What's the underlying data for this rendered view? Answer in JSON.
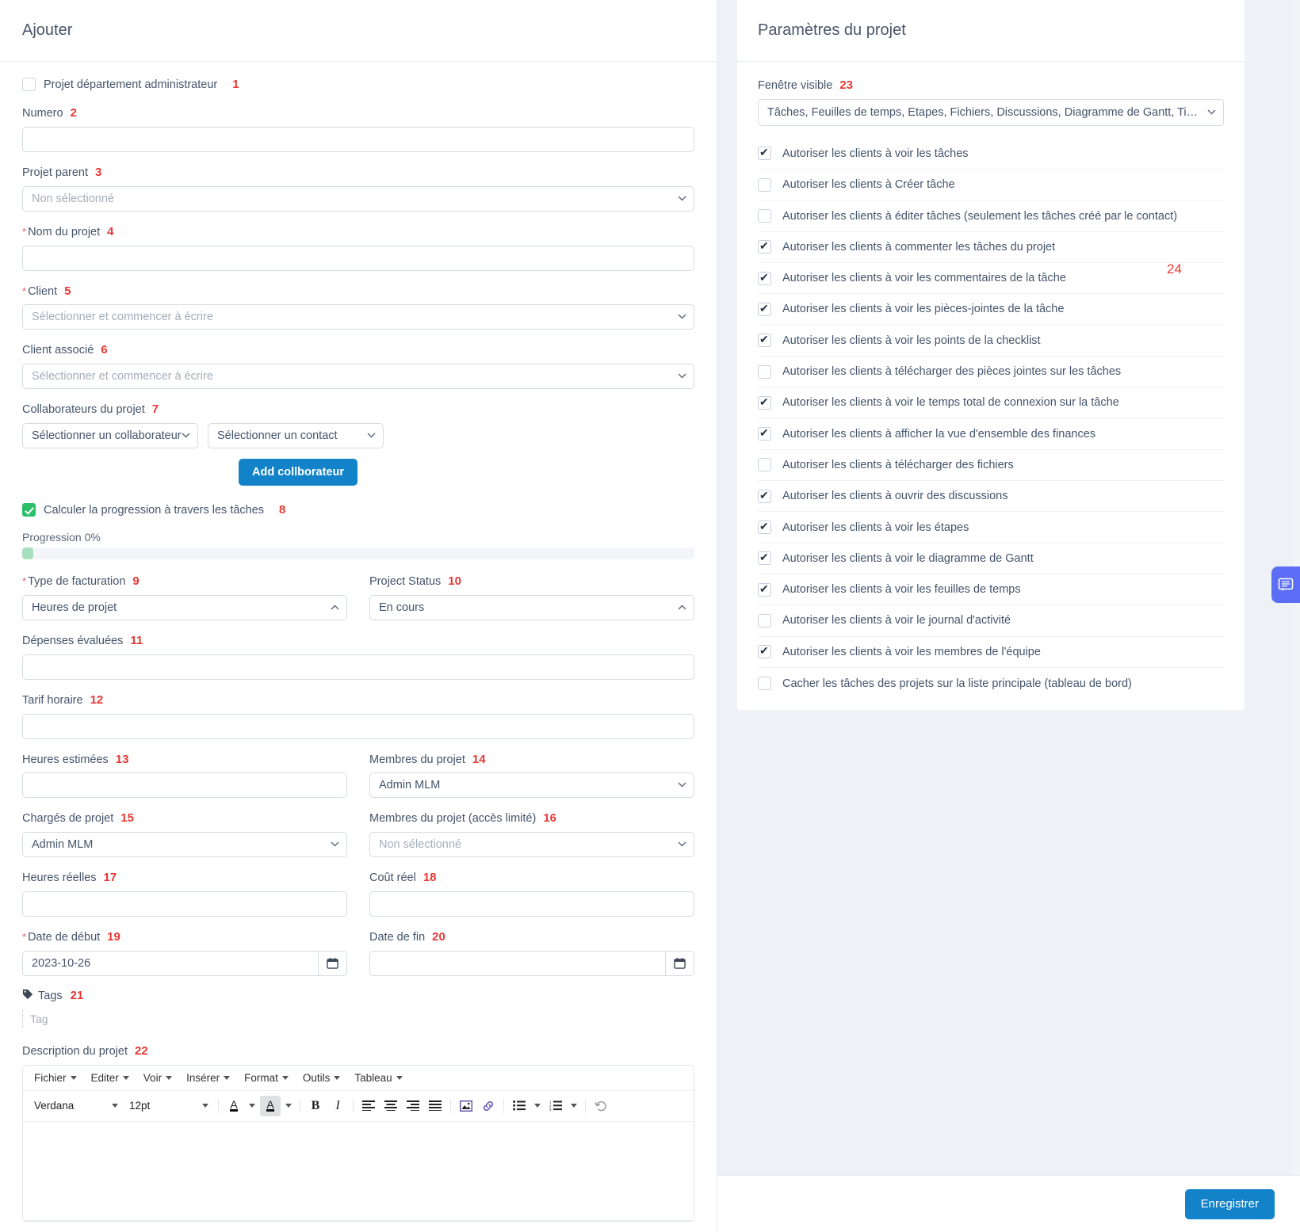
{
  "left": {
    "title": "Ajouter",
    "admin_project": {
      "label": "Projet département administrateur",
      "num": "1",
      "checked": false
    },
    "numero": {
      "label": "Numero",
      "num": "2",
      "value": ""
    },
    "projet_parent": {
      "label": "Projet parent",
      "num": "3",
      "value": "Non sélectionné"
    },
    "nom_projet": {
      "label": "Nom du projet",
      "num": "4",
      "value": "",
      "required": true
    },
    "client": {
      "label": "Client",
      "num": "5",
      "value": "Sélectionner et commencer à écrire",
      "required": true
    },
    "client_associe": {
      "label": "Client associé",
      "num": "6",
      "value": "Sélectionner et commencer à écrire"
    },
    "collaborateurs": {
      "label": "Collaborateurs du projet",
      "num": "7",
      "collaborateur_value": "Sélectionner un collaborateur",
      "contact_value": "Sélectionner un contact",
      "add_button": "Add collborateur"
    },
    "calc_progress": {
      "label": "Calculer la progression à travers les tâches",
      "num": "8",
      "checked": true
    },
    "progression": {
      "label": "Progression 0%",
      "percent": 0
    },
    "type_facturation": {
      "label": "Type de facturation",
      "num": "9",
      "value": "Heures de projet",
      "required": true
    },
    "project_status": {
      "label": "Project Status",
      "num": "10",
      "value": "En cours"
    },
    "depenses": {
      "label": "Dépenses évaluées",
      "num": "11",
      "value": ""
    },
    "tarif_horaire": {
      "label": "Tarif horaire",
      "num": "12",
      "value": ""
    },
    "heures_estimees": {
      "label": "Heures estimées",
      "num": "13",
      "value": ""
    },
    "membres_projet": {
      "label": "Membres du projet",
      "num": "14",
      "value": "Admin MLM"
    },
    "charges_projet": {
      "label": "Chargés de projet",
      "num": "15",
      "value": "Admin MLM"
    },
    "membres_limite": {
      "label": "Membres du projet (accès limité)",
      "num": "16",
      "value": "Non sélectionné"
    },
    "heures_reelles": {
      "label": "Heures réelles",
      "num": "17",
      "value": ""
    },
    "cout_reel": {
      "label": "Coût réel",
      "num": "18",
      "value": ""
    },
    "date_debut": {
      "label": "Date de début",
      "num": "19",
      "value": "2023-10-26",
      "required": true
    },
    "date_fin": {
      "label": "Date de fin",
      "num": "20",
      "value": ""
    },
    "tags": {
      "label": "Tags",
      "num": "21",
      "placeholder": "Tag"
    },
    "description": {
      "label": "Description du projet",
      "num": "22"
    }
  },
  "editor": {
    "menus": [
      "Fichier",
      "Editer",
      "Voir",
      "Insérer",
      "Format",
      "Outils",
      "Tableau"
    ],
    "font_family": "Verdana",
    "font_size": "12pt",
    "content": ""
  },
  "right": {
    "title": "Paramètres du projet",
    "fenetre_visible": {
      "label": "Fenêtre visible",
      "num": "23",
      "value": "Tâches, Feuilles de temps, Etapes, Fichiers, Discussions, Diagramme de Gantt, Tickets, ..."
    },
    "permissions_num": "24",
    "permissions": [
      {
        "label": "Autoriser les clients à voir les tâches",
        "checked": true
      },
      {
        "label": "Autoriser les clients à Créer tâche",
        "checked": false
      },
      {
        "label": "Autoriser les clients à éditer tâches (seulement les tâches créé par le contact)",
        "checked": false
      },
      {
        "label": "Autoriser les clients à commenter les tâches du projet",
        "checked": true
      },
      {
        "label": "Autoriser les clients à voir les commentaires de la tâche",
        "checked": true
      },
      {
        "label": "Autoriser les clients à voir les pièces-jointes de la tâche",
        "checked": true
      },
      {
        "label": "Autoriser les clients à voir les points de la checklist",
        "checked": true
      },
      {
        "label": "Autoriser les clients à télécharger des pièces jointes sur les tâches",
        "checked": false
      },
      {
        "label": "Autoriser les clients à voir le temps total de connexion sur la tâche",
        "checked": true
      },
      {
        "label": "Autoriser les clients à afficher la vue d'ensemble des finances",
        "checked": true
      },
      {
        "label": "Autoriser les clients à télécharger des fichiers",
        "checked": false
      },
      {
        "label": "Autoriser les clients à ouvrir des discussions",
        "checked": true
      },
      {
        "label": "Autoriser les clients à voir les étapes",
        "checked": true
      },
      {
        "label": "Autoriser les clients à voir le diagramme de Gantt",
        "checked": true
      },
      {
        "label": "Autoriser les clients à voir les feuilles de temps",
        "checked": true
      },
      {
        "label": "Autoriser les clients à voir le journal d'activité",
        "checked": false
      },
      {
        "label": "Autoriser les clients à voir les membres de l'équipe",
        "checked": true
      },
      {
        "label": "Cacher les tâches des projets sur la liste principale (tableau de bord)",
        "checked": false
      }
    ]
  },
  "footer": {
    "save_label": "Enregistrer"
  },
  "colors": {
    "accent": "#1283c8",
    "annotation": "#e53935",
    "checked_green": "#2bbf6a",
    "chat": "#5b6ef5"
  }
}
